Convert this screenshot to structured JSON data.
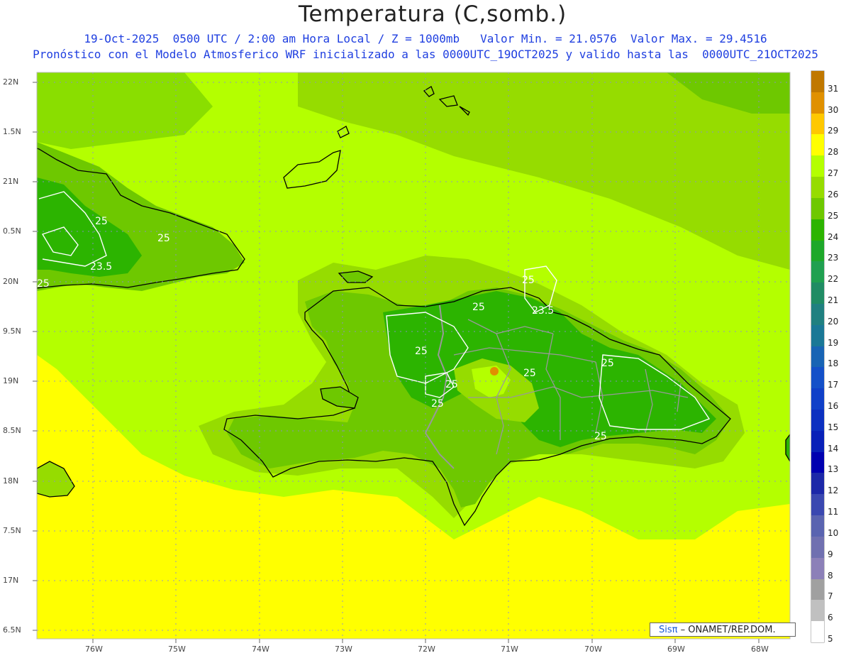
{
  "header": {
    "title": "Temperatura (C,somb.)",
    "line1": "19-Oct-2025  0500 UTC / 2:00 am Hora Local / Z = 1000mb   Valor Min. = 21.0576  Valor Max. = 29.4516",
    "line2": "Pronóstico con el Modelo Atmosferico WRF inicializado a las 0000UTC_19OCT2025 y valido hasta las  0000UTC_21OCT2025"
  },
  "map": {
    "lat_labels": [
      "22N",
      "1.5N",
      "21N",
      "0.5N",
      "20N",
      "9.5N",
      "19N",
      "8.5N",
      "18N",
      "7.5N",
      "17N",
      "6.5N"
    ],
    "lon_labels": [
      "76W",
      "75W",
      "74W",
      "73W",
      "72W",
      "71W",
      "70W",
      "69W",
      "68W"
    ],
    "contour_labels": [
      "25",
      "25",
      "23.5",
      "25",
      "25",
      "25",
      "23.5",
      "25",
      "25",
      "25",
      "25",
      "25",
      "25",
      "25"
    ]
  },
  "colorbar": {
    "labels": [
      "31",
      "30",
      "29",
      "28",
      "27",
      "26",
      "25",
      "24",
      "23",
      "22",
      "21",
      "20",
      "19",
      "18",
      "17",
      "16",
      "15",
      "14",
      "13",
      "12",
      "11",
      "10",
      "9",
      "8",
      "7",
      "6",
      "5"
    ],
    "colors": [
      "#c07800",
      "#e09000",
      "#ffc800",
      "#ffff00",
      "#b4ff00",
      "#96dc00",
      "#6ec800",
      "#2cb400",
      "#1ea82a",
      "#20a050",
      "#208c64",
      "#208080",
      "#1a7896",
      "#1864b4",
      "#1450c8",
      "#1040c8",
      "#0c30c0",
      "#0820b8",
      "#0000b0",
      "#1c28a8",
      "#3a48b0",
      "#5a64b0",
      "#7070b0",
      "#8c80b8",
      "#a0a0a0",
      "#c0c0c0",
      "#ffffff"
    ]
  },
  "logo": {
    "brand": "Sisπ",
    "text": " – ONAMET/REP.DOM."
  },
  "palette": {
    "sea_warm": "#ffff00",
    "sea_mid": "#b4ff00",
    "land_a": "#96dc00",
    "land_b": "#6ec800",
    "land_c": "#2cb400",
    "contour": "#ffffff",
    "coast": "#000000",
    "border": "#999999"
  }
}
